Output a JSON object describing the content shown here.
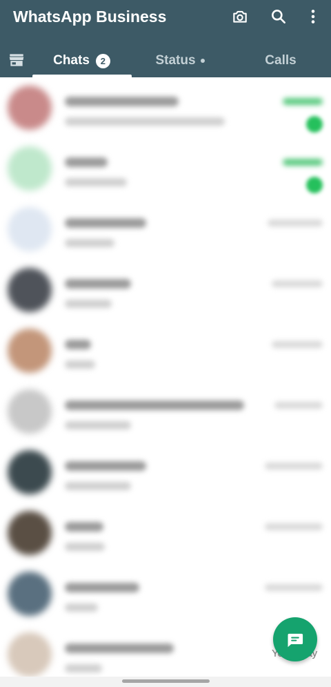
{
  "app": {
    "title": "WhatsApp Business",
    "brand_color": "#3d5a66",
    "accent_color": "#15a36e"
  },
  "toolbar": {
    "icons": [
      "camera-icon",
      "search-icon",
      "more-vert-icon"
    ]
  },
  "tabs": {
    "store_icon": "storefront-icon",
    "chats_label": "Chats",
    "chats_badge": "2",
    "status_label": "Status",
    "calls_label": "Calls",
    "active": "Chats"
  },
  "chat_list": {
    "note": "",
    "rows": [
      {
        "avatar_color": "#c98a8a",
        "unread": true
      },
      {
        "avatar_color": "#bfe8cc",
        "unread": true
      },
      {
        "avatar_color": "#dfe7f2",
        "unread": false
      },
      {
        "avatar_color": "#4f535a",
        "unread": false
      },
      {
        "avatar_color": "#c3967a",
        "unread": false
      },
      {
        "avatar_color": "#c8c8c8",
        "unread": false
      },
      {
        "avatar_color": "#3c4a4f",
        "unread": false
      },
      {
        "avatar_color": "#5a4f44",
        "unread": false
      },
      {
        "avatar_color": "#5a7080",
        "unread": false
      },
      {
        "avatar_color": "#d8c9bb",
        "unread": false
      }
    ]
  },
  "fab": {
    "icon": "new-chat-icon"
  },
  "ghost_text": "Yesterday"
}
